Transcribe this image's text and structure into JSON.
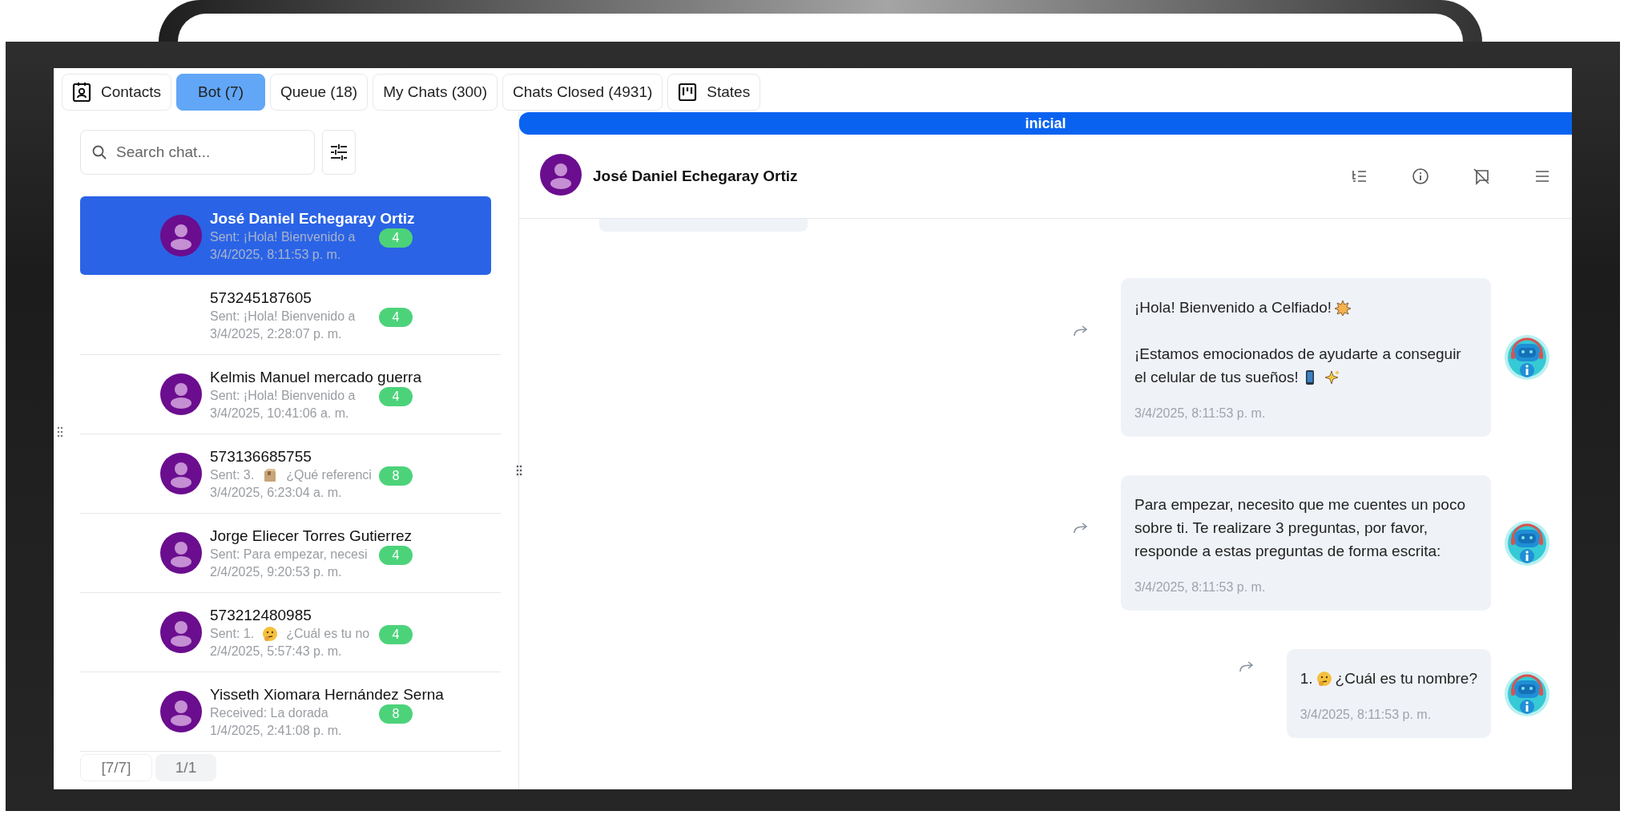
{
  "tabs": [
    {
      "label": "Contacts",
      "kind": "contacts",
      "selected": false
    },
    {
      "label": "Bot (7)",
      "kind": "plain",
      "selected": true
    },
    {
      "label": "Queue (18)",
      "kind": "plain",
      "selected": false
    },
    {
      "label": "My Chats (300)",
      "kind": "plain",
      "selected": false
    },
    {
      "label": "Chats Closed (4931)",
      "kind": "plain",
      "selected": false
    },
    {
      "label": "States",
      "kind": "board",
      "selected": false
    }
  ],
  "search": {
    "placeholder": "Search chat..."
  },
  "chats": [
    {
      "name": "José Daniel Echegaray Ortiz",
      "avatar": true,
      "preview": [
        {
          "kind": "text",
          "text": "Sent: ¡Hola! Bienvenido a"
        }
      ],
      "date": "3/4/2025, 8:11:53 p. m.",
      "unread": "4",
      "selected": true
    },
    {
      "name": "573245187605",
      "avatar": false,
      "preview": [
        {
          "kind": "text",
          "text": "Sent: ¡Hola! Bienvenido a"
        }
      ],
      "date": "3/4/2025, 2:28:07 p. m.",
      "unread": "4",
      "selected": false
    },
    {
      "name": "Kelmis Manuel mercado guerra",
      "avatar": true,
      "preview": [
        {
          "kind": "text",
          "text": "Sent: ¡Hola! Bienvenido a"
        }
      ],
      "date": "3/4/2025, 10:41:06 a. m.",
      "unread": "4",
      "selected": false
    },
    {
      "name": "573136685755",
      "avatar": true,
      "preview": [
        {
          "kind": "text",
          "text": "Sent: 3."
        },
        {
          "kind": "box"
        },
        {
          "kind": "text",
          "text": "¿Qué referenci"
        }
      ],
      "date": "3/4/2025, 6:23:04 a. m.",
      "unread": "8",
      "selected": false
    },
    {
      "name": "Jorge Eliecer Torres Gutierrez",
      "avatar": true,
      "preview": [
        {
          "kind": "text",
          "text": "Sent: Para empezar, necesi"
        }
      ],
      "date": "2/4/2025, 9:20:53 p. m.",
      "unread": "4",
      "selected": false
    },
    {
      "name": "573212480985",
      "avatar": true,
      "preview": [
        {
          "kind": "text",
          "text": "Sent: 1."
        },
        {
          "kind": "thinking"
        },
        {
          "kind": "text",
          "text": "¿Cuál es tu no"
        }
      ],
      "date": "2/4/2025, 5:57:43 p. m.",
      "unread": "4",
      "selected": false
    },
    {
      "name": "Yisseth Xiomara Hernández Serna",
      "avatar": true,
      "preview": [
        {
          "kind": "text",
          "text": "Received: La dorada"
        }
      ],
      "date": "1/4/2025, 2:41:08 p. m.",
      "unread": "8",
      "selected": false
    }
  ],
  "pagination": [
    "[7/7]",
    "1/1"
  ],
  "conversation": {
    "status": "inicial",
    "contact": "José Daniel Echegaray Ortiz",
    "messages": [
      {
        "paragraphs": [
          [
            {
              "kind": "text",
              "text": "¡Hola! Bienvenido a Celfiado!"
            },
            {
              "kind": "burst"
            }
          ],
          [
            {
              "kind": "text",
              "text": "¡Estamos emocionados de ayudarte a conseguir"
            },
            {
              "kind": "text",
              "text": "el celular de tus sueños!"
            },
            {
              "kind": "phone"
            },
            {
              "kind": "sparkles"
            }
          ]
        ],
        "time": "3/4/2025, 8:11:53 p. m."
      },
      {
        "paragraphs": [
          [
            {
              "kind": "text",
              "text": "Para empezar, necesito que me cuentes un poco sobre ti. Te realizare 3 preguntas, por favor, responde a estas preguntas de forma escrita:"
            }
          ]
        ],
        "time": "3/4/2025, 8:11:53 p. m."
      },
      {
        "paragraphs": [
          [
            {
              "kind": "text",
              "text": "1."
            },
            {
              "kind": "thinking"
            },
            {
              "kind": "text",
              "text": "¿Cuál es tu nombre?"
            }
          ]
        ],
        "time": "3/4/2025, 8:11:53 p. m."
      }
    ]
  }
}
